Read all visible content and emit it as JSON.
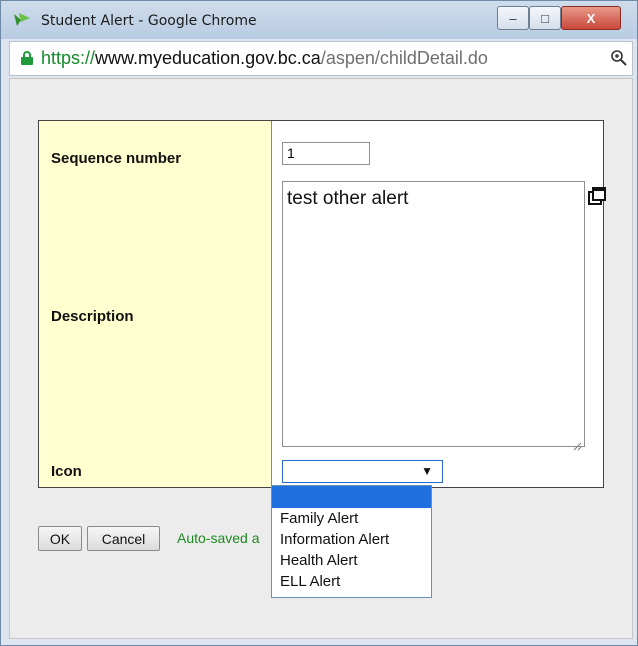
{
  "window": {
    "title": "Student Alert - Google Chrome",
    "close_label": "X",
    "min_label": "–",
    "max_label": "□"
  },
  "address": {
    "scheme": "https://",
    "host": "www.myeducation.gov.bc.ca",
    "path": "/aspen/childDetail.do"
  },
  "form": {
    "sequence_label": "Sequence number",
    "sequence_value": "1",
    "description_label": "Description",
    "description_value": "test other alert",
    "icon_label": "Icon",
    "icon_value": "",
    "icon_options": [
      "",
      "Family Alert",
      "Information Alert",
      "Health Alert",
      "ELL Alert"
    ]
  },
  "actions": {
    "ok_label": "OK",
    "cancel_label": "Cancel",
    "autosave_text": "Auto-saved a"
  },
  "colors": {
    "label_column_bg": "#ffffcf",
    "autosave_text": "#1d8a1d",
    "selected_option": "#1f6fe0"
  },
  "icons": [
    "app-icon",
    "lock-icon",
    "zoom-icon",
    "expand-icon",
    "dropdown-arrow-icon",
    "resize-handle-icon"
  ]
}
